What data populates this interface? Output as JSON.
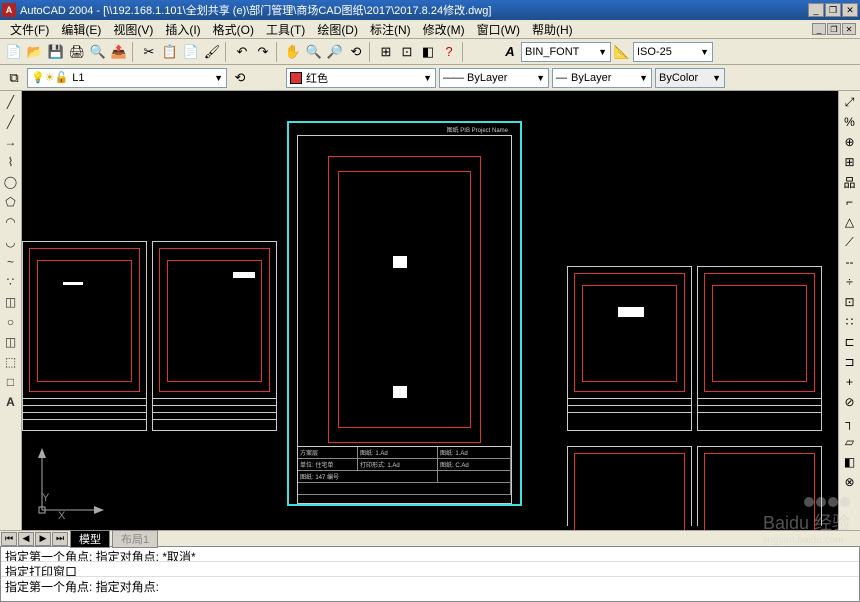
{
  "titlebar": {
    "app_icon_text": "A",
    "title": "AutoCAD 2004 - [\\\\192.168.1.101\\全划共享 (e)\\部门管理\\商场CAD图纸\\2017\\2017.8.24修改.dwg]"
  },
  "menu": {
    "items": [
      "文件(F)",
      "编辑(E)",
      "视图(V)",
      "插入(I)",
      "格式(O)",
      "工具(T)",
      "绘图(D)",
      "标注(N)",
      "修改(M)",
      "窗口(W)",
      "帮助(H)"
    ]
  },
  "toolbar2": {
    "font_label": "BIN_FONT",
    "dim_style": "ISO-25"
  },
  "layerbar": {
    "layer": "L1",
    "color_name": "红色",
    "linetype": "ByLayer",
    "lineweight": "ByLayer",
    "plotstyle": "ByColor",
    "accent_red": "#d33333"
  },
  "left_tools": [
    "╱",
    "╱",
    "→",
    "⌇",
    "◯",
    "⬠",
    "◠",
    "◡",
    "~",
    "∵",
    "◫",
    "○",
    "◫",
    "⬚",
    "□",
    "A"
  ],
  "right_tools": [
    "⤢",
    "%",
    "⊕",
    "⊞",
    "品",
    "⌐",
    "△",
    "⟋",
    "--",
    "÷",
    "⊡",
    "∷",
    "⊏",
    "⊐",
    "+",
    "⊘",
    "┐",
    "▱",
    "◧",
    "⊗"
  ],
  "tabs": {
    "nav": [
      "⏮",
      "◀",
      "▶",
      "⏭"
    ],
    "active": "模型",
    "inactive1": "布局1"
  },
  "command": {
    "line1": "指定第一个角点: 指定对角点: *取消*",
    "line2": "指定打印窗口",
    "prompt": "指定第一个角点: 指定对角点:"
  },
  "center_drawing": {
    "top_label": "图纸 PIB Project Name",
    "tb": {
      "r1c1": "方案层",
      "r1c2": "图纸: 1.Ad",
      "r1c3": "图纸: 1.Ad",
      "r2c1": "单位: 住宅单",
      "r2c2": "打印形式: 1.Ad",
      "r2c3": "图纸: C.Ad",
      "r3c1": "图纸: 147 编号"
    }
  },
  "watermark": {
    "main": "Baidu 经验",
    "sub": "jingyan.baidu.com"
  }
}
